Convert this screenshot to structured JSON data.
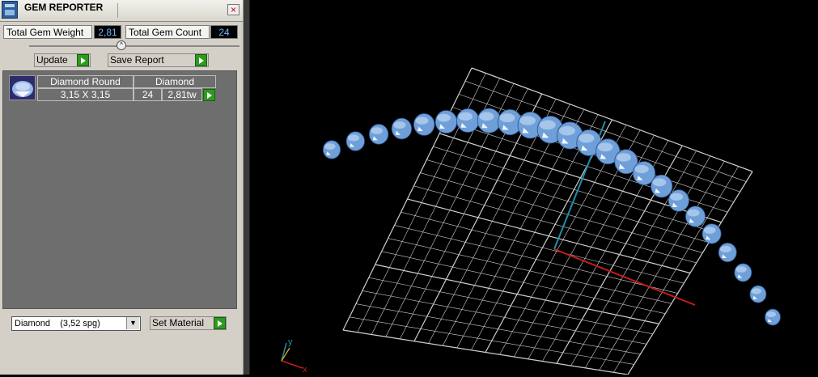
{
  "window": {
    "title": "GEM REPORTER",
    "close_label": "×"
  },
  "totals": {
    "weight_label": "Total Gem Weight",
    "weight_value": "2,81",
    "count_label": "Total Gem Count",
    "count_value": "24"
  },
  "toolbar": {
    "update_label": "Update",
    "save_report_label": "Save Report"
  },
  "gem_list": [
    {
      "shape": "Diamond Round",
      "material": "Diamond",
      "size": "3,15 X 3,15",
      "count": "24",
      "weight": "2,81tw"
    }
  ],
  "material": {
    "selected_name": "Diamond",
    "selected_spg": "(3,52 spg)",
    "set_label": "Set Material"
  },
  "axis": {
    "x_label": "x",
    "y_label": "y"
  },
  "colors": {
    "gem": "#6f9fd8",
    "grid": "#cfcfcf",
    "x_axis": "#c41e1e",
    "y_axis": "#1f8fa8",
    "go_button": "#2c9b1e",
    "value_text": "#6fb6ff"
  }
}
